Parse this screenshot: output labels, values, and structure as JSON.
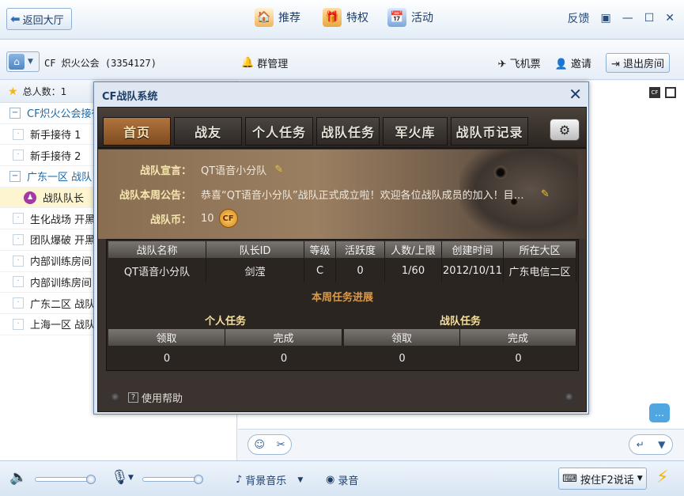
{
  "topbar": {
    "back_label": "返回大厅",
    "nav": [
      {
        "label": "推荐",
        "icon": "house-icon"
      },
      {
        "label": "特权",
        "icon": "gift-icon"
      },
      {
        "label": "活动",
        "icon": "calendar-icon"
      }
    ],
    "feedback_label": "反馈"
  },
  "room": {
    "name": "CF 炽火公会 (3354127)",
    "group_mgr_label": "群管理",
    "ticket_label": "飞机票",
    "invite_label": "邀请",
    "exit_label": "退出房间"
  },
  "sidebar": {
    "total_label": "总人数：1",
    "items": [
      {
        "label": "CF炽火公会接待",
        "kind": "group",
        "toggle": "−"
      },
      {
        "label": "新手接待 1",
        "kind": "channel",
        "toggle": "·"
      },
      {
        "label": "新手接待 2",
        "kind": "channel",
        "toggle": "·"
      },
      {
        "label": "广东一区 战队",
        "kind": "group",
        "toggle": "−"
      },
      {
        "label": "战队队长",
        "kind": "member",
        "toggle": ""
      },
      {
        "label": "生化战场 开黑",
        "kind": "channel",
        "toggle": "·"
      },
      {
        "label": "团队爆破 开黑",
        "kind": "channel",
        "toggle": "·"
      },
      {
        "label": "内部训练房间",
        "kind": "channel",
        "toggle": "·"
      },
      {
        "label": "内部训练房间",
        "kind": "channel",
        "toggle": "·"
      },
      {
        "label": "广东二区 战队",
        "kind": "channel",
        "toggle": "·"
      },
      {
        "label": "上海一区 战队",
        "kind": "channel",
        "toggle": "·"
      }
    ]
  },
  "dialog": {
    "title": "CF战队系统",
    "tabs": [
      "首页",
      "战友",
      "个人任务",
      "战队任务",
      "军火库",
      "战队币记录"
    ],
    "declaration_label": "战队宣言：",
    "declaration_value": "QT语音小分队",
    "notice_label": "战队本周公告：",
    "notice_value": "恭喜“QT语音小分队”战队正式成立啦！欢迎各位战队成员的加入！目…",
    "coins_label": "战队币：",
    "coins_value": "10",
    "coin_badge": "CF",
    "table": {
      "headers": [
        "战队名称",
        "队长ID",
        "等级",
        "活跃度",
        "人数/上限",
        "创建时间",
        "所在大区"
      ],
      "row": [
        "QT语音小分队",
        "剑滢",
        "C",
        "0",
        "1/60",
        "2012/10/11",
        "广东电信二区"
      ]
    },
    "progress_title": "本周任务进展",
    "personal_title": "个人任务",
    "team_title": "战队任务",
    "progress_headers": [
      "领取",
      "完成"
    ],
    "personal_values": [
      "0",
      "0"
    ],
    "team_values": [
      "0",
      "0"
    ],
    "help_label": "使用帮助"
  },
  "bottombar": {
    "music_label": "背景音乐",
    "record_label": "录音",
    "f2_label": "按住F2说话"
  }
}
